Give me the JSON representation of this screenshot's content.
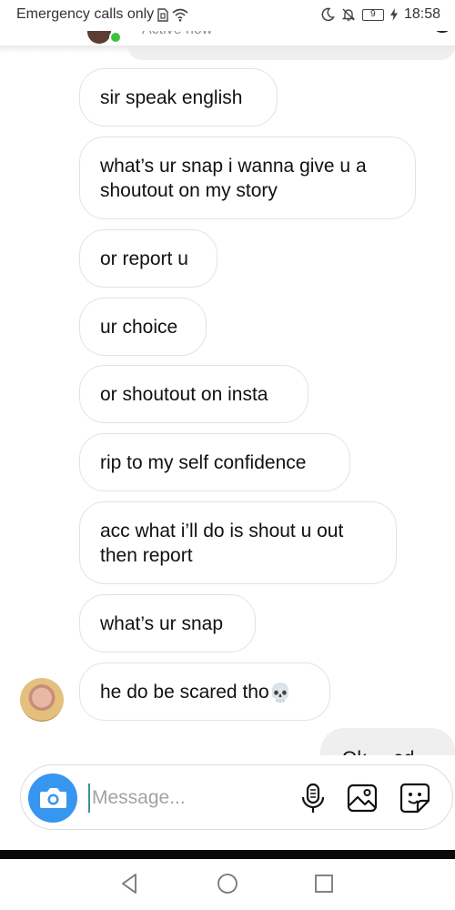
{
  "status_bar": {
    "carrier": "Emergency calls only",
    "battery": "9",
    "time": "18:58"
  },
  "header": {
    "status": "Active now"
  },
  "messages": [
    {
      "text": "sir speak english"
    },
    {
      "text_line1": "what’s ur snap i wanna give u a",
      "text_line2": "shoutout on my story"
    },
    {
      "text": "or report u"
    },
    {
      "text": "ur choice"
    },
    {
      "text": "or shoutout on insta"
    },
    {
      "text": "rip to my self confidence"
    },
    {
      "text_line1": "acc what i’ll do is shout u out",
      "text_line2": "then report"
    },
    {
      "text": "what’s ur snap"
    },
    {
      "text": "he do be scared tho",
      "emoji": "💀"
    }
  ],
  "sent_partial": {
    "text": "Ok ... ed"
  },
  "composer": {
    "placeholder": "Message...",
    "icons": [
      "camera-icon",
      "microphone-icon",
      "gallery-icon",
      "sticker-icon"
    ]
  },
  "nav_bar": {
    "icons": [
      "back-icon",
      "home-icon",
      "recents-icon"
    ]
  },
  "colors": {
    "accent": "#3797f0",
    "online": "#3cc23c",
    "bubble_border": "#e3e3e3"
  }
}
